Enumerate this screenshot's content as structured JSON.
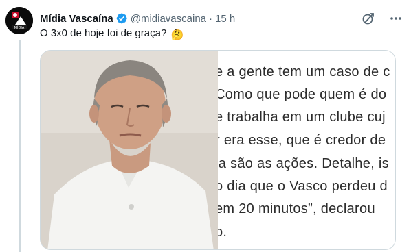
{
  "author": {
    "name": "Mídia Vascaína",
    "handle": "@midiavascaina",
    "separator": "·",
    "time": "15 h",
    "avatar_label": "MÍDIA"
  },
  "tweet": {
    "text": "O 3x0 de hoje foi de graça?",
    "emoji": "🤔"
  },
  "media": {
    "text_lines": [
      "e a gente tem um caso de c",
      "Como que pode quem é do",
      "e trabalha em um clube cuj",
      "r era esse, que é credor de",
      "ia são as ações. Detalhe, is",
      "o dia que o Vasco perdeu d",
      "em 20 minutos”, declarou",
      "o."
    ]
  },
  "icons": {
    "verified": "verified-badge-icon",
    "grok": "grok-icon",
    "more": "more-options-icon"
  },
  "colors": {
    "verified_blue": "#1d9bf0",
    "secondary_text": "#536471",
    "border": "#cfd9de"
  }
}
